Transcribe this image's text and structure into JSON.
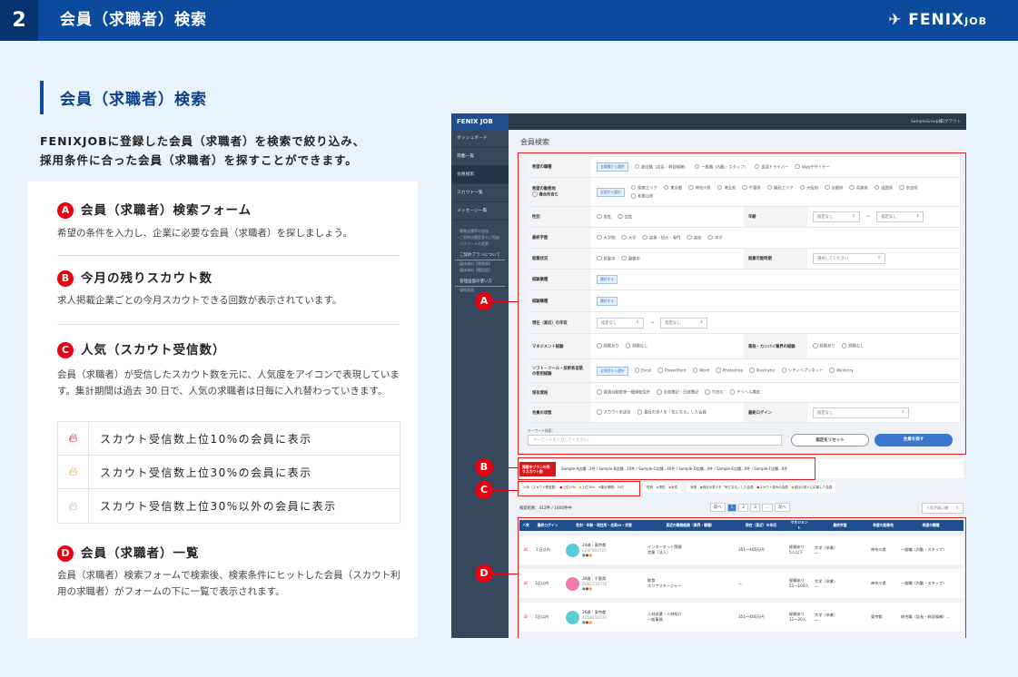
{
  "header": {
    "section_number": "2",
    "title": "会員（求職者）検索",
    "logo": "FENIX",
    "logo_sub": "JOB"
  },
  "section": {
    "title": "会員（求職者）検索",
    "intro": [
      "FENIXJOBに登録した会員（求職者）を検索で絞り込み、",
      "採用条件に合った会員（求職者）を探すことができます。"
    ]
  },
  "items": [
    {
      "badge": "A",
      "title": "会員（求職者）検索フォーム",
      "desc": "希望の条件を入力し、企業に必要な会員（求職者）を探しましょう。"
    },
    {
      "badge": "B",
      "title": "今月の残りスカウト数",
      "desc": "求人掲載企業ごとの今月スカウトできる回数が表示されています。"
    },
    {
      "badge": "C",
      "title": "人気（スカウト受信数）",
      "desc": "会員（求職者）が受信したスカウト数を元に、人気度をアイコンで表現しています。集計期間は過去 30 日で、人気の求職者は日毎に入れ替わっていきます。"
    },
    {
      "badge": "D",
      "title": "会員（求職者）一覧",
      "desc": "会員（求職者）検索フォームで検索後、検索条件にヒットした会員（スカウト利用の求職者）がフォームの下に一覧で表示されます。"
    }
  ],
  "popularity": [
    {
      "icon": "flame-red-icon",
      "color": "#e60012",
      "label": "スカウト受信数上位10%の会員に表示"
    },
    {
      "icon": "flame-yellow-icon",
      "color": "#f5b400",
      "label": "スカウト受信数上位30%の会員に表示"
    },
    {
      "icon": "flame-gray-icon",
      "color": "#bbbbbb",
      "label": "スカウト受信数上位30%以外の会員に表示"
    }
  ],
  "screenshot": {
    "logo": "FENIX JOB",
    "user": "SampleGroup様",
    "logout": "ログアウト",
    "nav": [
      "ダッシュボード",
      "掲載一覧",
      "会員検索",
      "スカウト一覧",
      "メッセージ一覧"
    ],
    "links": [
      "・募集店舗等の追加",
      "・ご契約店舗変更のご相談",
      "・パスワードの変更"
    ],
    "plan_head": "ご契約プランについて",
    "plan_links": [
      "・媒体資料【関東版】",
      "・媒体資料【関西版】"
    ],
    "manual_head": "管理画面の使い方",
    "manual_links": [
      "・管理画面"
    ],
    "page_title": "会員検索",
    "form": {
      "job_type": {
        "label": "希望の職種",
        "chip": "全職種から選択",
        "options": [
          "総合職（店長・幹部候補）",
          "一般職（内勤・スタッフ）",
          "送迎ドライバー",
          "Webデザイナー"
        ]
      },
      "area": {
        "label": "希望の勤務地",
        "sub": "複合所含む",
        "chip": "全国から選択",
        "options": [
          "関東エリア",
          "東京都",
          "神奈川県",
          "埼玉県",
          "千葉県",
          "関西エリア",
          "大阪府",
          "京都府",
          "兵庫県",
          "滋賀県",
          "奈良県",
          "和歌山県"
        ]
      },
      "gender": {
        "label": "性別",
        "options": [
          "男性",
          "女性"
        ]
      },
      "age": {
        "label": "年齢",
        "from": "指定なし",
        "to": "指定なし"
      },
      "education": {
        "label": "最終学歴",
        "options": [
          "大学院",
          "大学",
          "高専・短大・専門",
          "高校",
          "中学"
        ]
      },
      "employment": {
        "label": "就業状況",
        "options": [
          "就業中",
          "離職中"
        ]
      },
      "start": {
        "label": "就業可能時期",
        "value": "選択してください"
      },
      "industry": {
        "label": "経験業種",
        "chip": "選択する"
      },
      "occupation": {
        "label": "経験職種",
        "chip": "選択する"
      },
      "income": {
        "label": "現在（直近）の年収",
        "from": "指定なし",
        "to": "指定なし"
      },
      "management": {
        "label": "マネジメント経験",
        "options": [
          "経験あり",
          "経験なし"
        ]
      },
      "kanbai": {
        "label": "風俗・カンバイ業界の経験",
        "options": [
          "経験あり",
          "経験なし"
        ]
      },
      "software": {
        "label": "ソフト・ツール・技術系言語の使用経験",
        "chip": "全項目から選択",
        "options": [
          "Excel",
          "PowerPoint",
          "Word",
          "Photoshop",
          "Illustrator",
          "シティヘブンネット",
          "WeVenry"
        ]
      },
      "license": {
        "label": "保有資格",
        "options": [
          "普通自動車第一種運転免許",
          "全商簿記・日商簿記",
          "TOEIC",
          "デリヘル検定"
        ]
      },
      "status": {
        "label": "会員の状態",
        "options": [
          "スカウト未送信",
          "貴社の求人を「気になる」した会員"
        ]
      },
      "last_login": {
        "label": "最終ログイン",
        "value": "指定なし"
      },
      "keyword_label": "キーワード検索：",
      "keyword_placeholder": "キーワードを入力してください。",
      "reset": "指定をリセット",
      "search": "会員を探す"
    },
    "scout": {
      "label": "掲載中プランの残りスカウト数",
      "text": "Sample-A店舗...3件 / Sample-B店舗...10件 / Sample-C店舗...40件 / Sample-D店舗...0件 / Sample-E店舗...0件 / Sample-F店舗...0件"
    },
    "legend": {
      "pop": "人気（スカウト受信数）",
      "pop_items": [
        "上位10%",
        "上位30%",
        "※集計期間：30日"
      ],
      "gender": "性別",
      "gender_items": [
        "男性",
        "女性"
      ],
      "state": "状態",
      "state_items": [
        "貴社の求人を「気になる」した会員",
        "スカウト済みの会員",
        "貴社の求人に応募した会員"
      ]
    },
    "result": {
      "count": "検索結果：412件 / 1600件中",
      "prev": "前へ",
      "pages": [
        "1",
        "2",
        "3",
        "..."
      ],
      "next": "次へ",
      "sort": "人気が高い順"
    },
    "table": {
      "headers": [
        "人気",
        "最終ログイン",
        "性別・年齢・現住所・会員ID・状態",
        "直近の職務経験（業界・職種）",
        "現在（直近）の年収",
        "マネジメント",
        "最終学歴",
        "希望の勤務地",
        "希望の職種"
      ],
      "rows": [
        {
          "login": "１日以内",
          "profile": "24歳｜東京都",
          "id": "C04F003720",
          "avatar": "#5ccbd8",
          "exp": [
            "インターネット関連",
            "営業（法人）"
          ],
          "income": "351〜400万円",
          "mgmt": [
            "経験あり",
            "5人以下"
          ],
          "edu": [
            "大学（卒業）",
            "―"
          ],
          "area": "神奈川県",
          "job": "一般職（内勤・スタッフ）"
        },
        {
          "login": "1日以内",
          "profile": "30歳｜千葉県",
          "id": "D06C210720",
          "avatar": "#f07aa8",
          "exp": [
            "飲食",
            "エリアマネージャー"
          ],
          "income": "―",
          "mgmt": [
            "経験あり",
            "51〜100人"
          ],
          "edu": [
            "大学（卒業）",
            "―"
          ],
          "area": "神奈川県",
          "job": "一般職（内勤・スタッフ）"
        },
        {
          "login": "1日以内",
          "profile": "26歳｜東京都",
          "id": "4D58150720",
          "avatar": "#5ccbd8",
          "exp": [
            "人材派遣・人材紹介",
            "一般事務"
          ],
          "income": "351〜400万円",
          "mgmt": [
            "経験あり",
            "11〜20人"
          ],
          "edu": [
            "大学（卒業）",
            "―"
          ],
          "area": "東京都",
          "job": "総合職（店長・幹部候補）..."
        }
      ]
    }
  },
  "callouts": [
    "A",
    "B",
    "C",
    "D"
  ]
}
